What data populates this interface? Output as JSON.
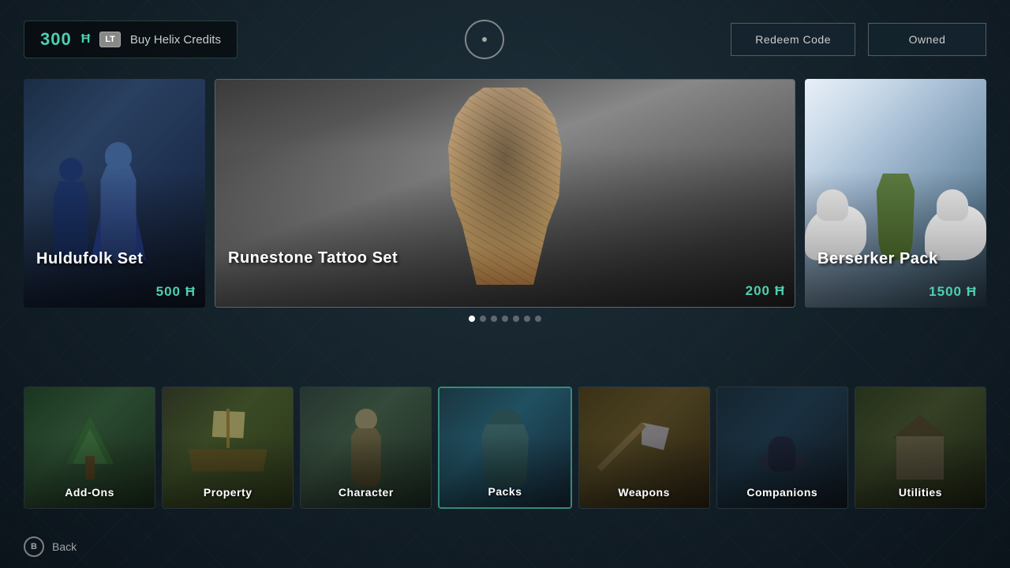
{
  "topBar": {
    "credits": {
      "amount": "300",
      "symbol": "Ħ",
      "ltBadge": "LT",
      "buyLabel": "Buy Helix Credits"
    },
    "redeemBtn": "Redeem Code",
    "ownedBtn": "Owned"
  },
  "featured": {
    "cards": [
      {
        "id": "huldufolk",
        "title": "Huldufolk Set",
        "price": "500 Ħ"
      },
      {
        "id": "runestone",
        "title": "Runestone Tattoo Set",
        "price": "200 Ħ"
      },
      {
        "id": "berserker",
        "title": "Berserker Pack",
        "price": "1500 Ħ"
      }
    ],
    "dots": [
      {
        "active": true
      },
      {
        "active": false
      },
      {
        "active": false
      },
      {
        "active": false
      },
      {
        "active": false
      },
      {
        "active": false
      },
      {
        "active": false
      }
    ]
  },
  "categories": [
    {
      "id": "addons",
      "label": "Add-Ons",
      "active": false
    },
    {
      "id": "property",
      "label": "Property",
      "active": false
    },
    {
      "id": "character",
      "label": "Character",
      "active": false
    },
    {
      "id": "packs",
      "label": "Packs",
      "active": true
    },
    {
      "id": "weapons",
      "label": "Weapons",
      "active": false
    },
    {
      "id": "companions",
      "label": "Companions",
      "active": false
    },
    {
      "id": "utilities",
      "label": "Utilities",
      "active": false
    }
  ],
  "bottomBar": {
    "backBadge": "B",
    "backLabel": "Back"
  }
}
